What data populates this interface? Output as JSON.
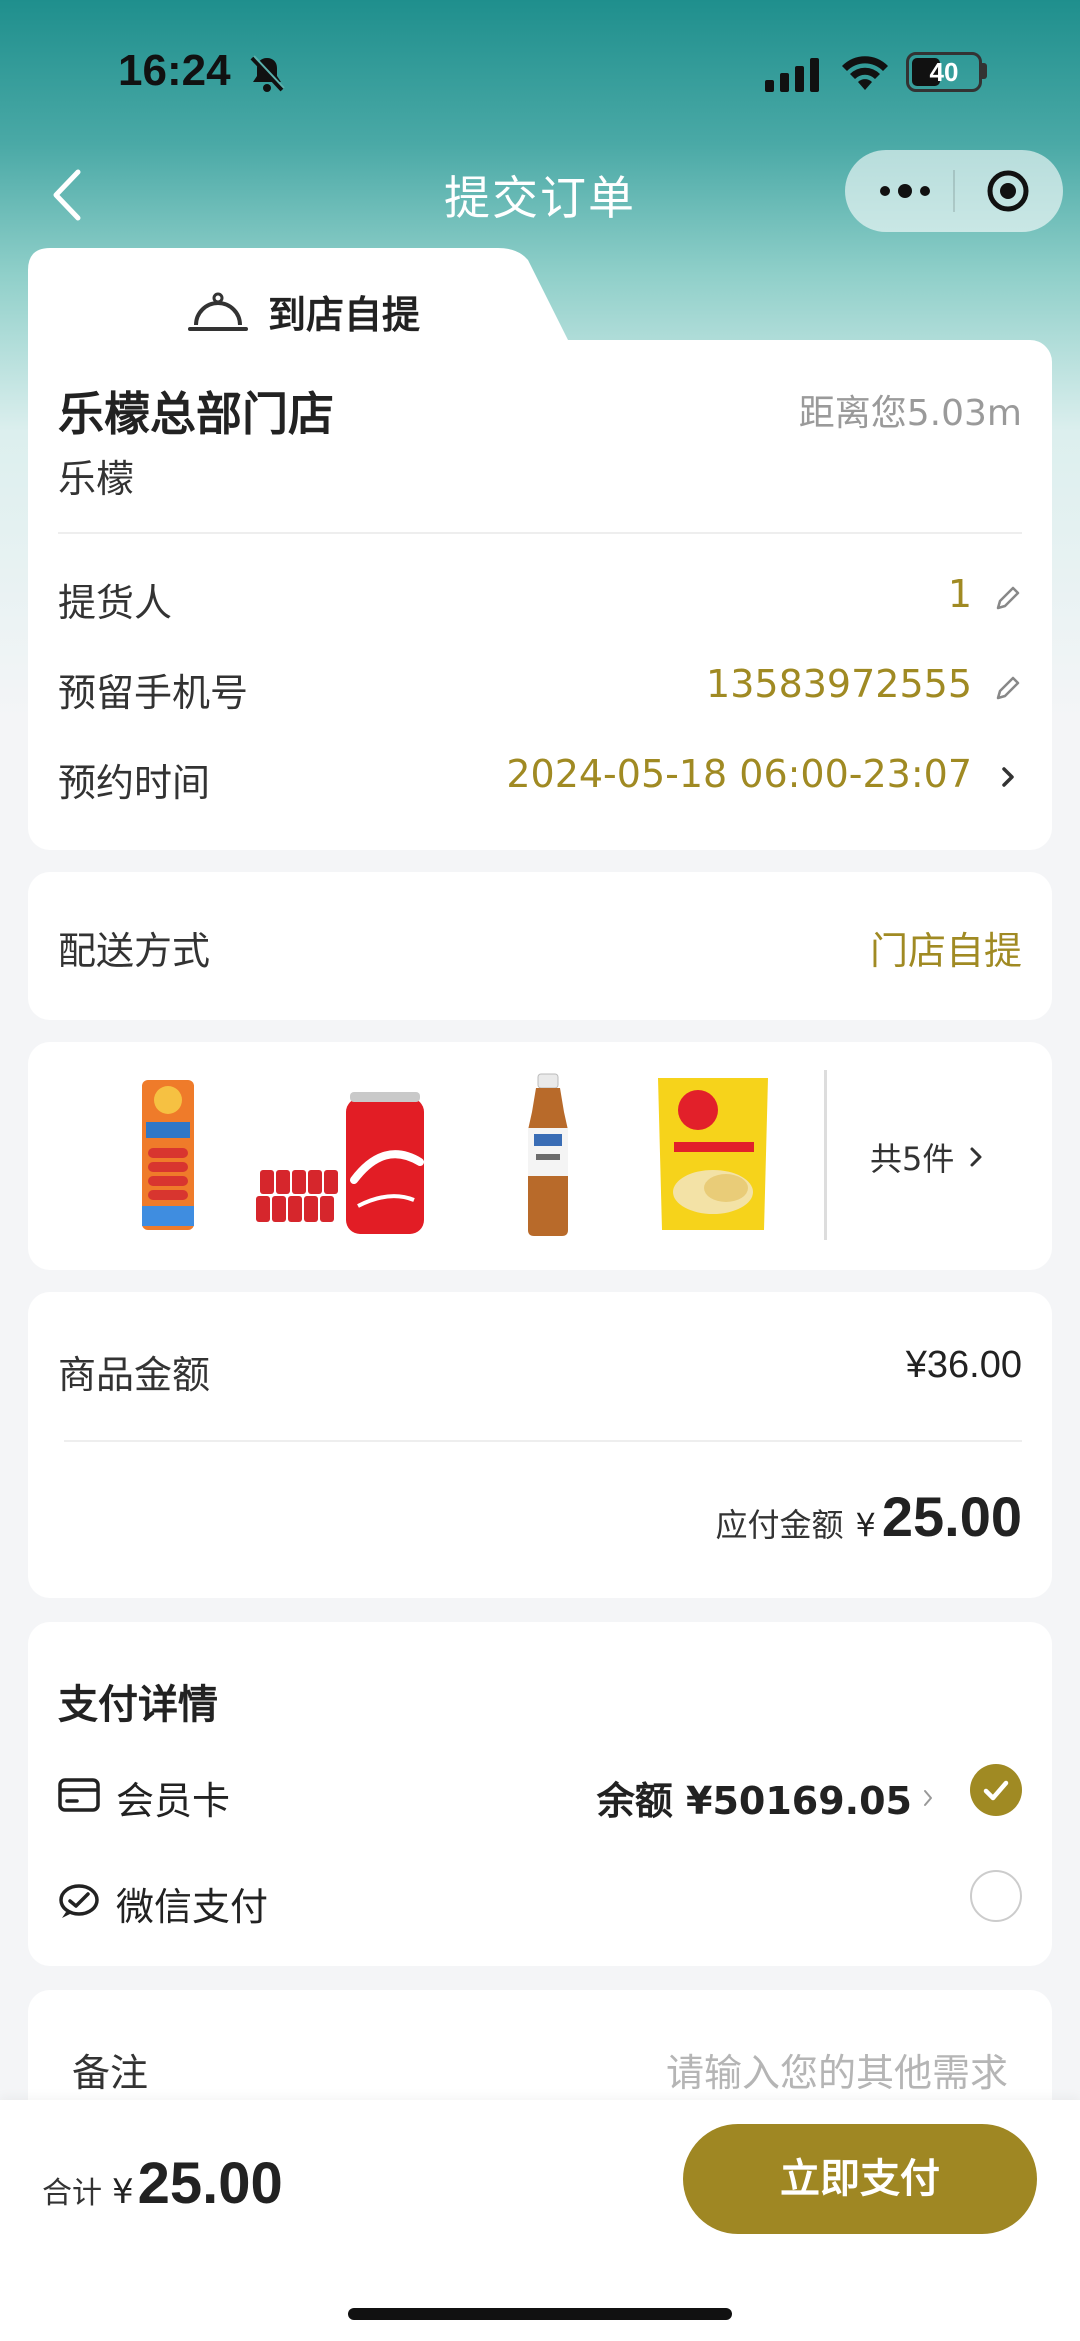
{
  "status_bar": {
    "time": "16:24",
    "battery": "40"
  },
  "nav": {
    "title": "提交订单"
  },
  "tab": {
    "label": "到店自提"
  },
  "store": {
    "name": "乐檬总部门店",
    "distance": "距离您5.03m",
    "brand": "乐檬"
  },
  "form": {
    "picker_label": "提货人",
    "picker_value": "1",
    "phone_label": "预留手机号",
    "phone_value": "13583972555",
    "time_label": "预约时间",
    "time_value": "2024-05-18 06:00-23:07"
  },
  "delivery": {
    "label": "配送方式",
    "value": "门店自提"
  },
  "goods": {
    "count_text": "共5件",
    "items": [
      "sausage-product",
      "coca-cola-cans",
      "tea-bottle",
      "lays-chips"
    ]
  },
  "amount": {
    "goods_label": "商品金额",
    "goods_value": "¥36.00",
    "payable_label": "应付金额",
    "currency": "¥",
    "payable_value": "25.00"
  },
  "payment": {
    "title": "支付详情",
    "member_card_label": "会员卡",
    "balance_text": "余额 ¥50169.05",
    "wechat_label": "微信支付"
  },
  "note": {
    "label": "备注",
    "placeholder": "请输入您的其他需求"
  },
  "bottom": {
    "total_label": "合计",
    "currency": "¥",
    "total_value": "25.00",
    "pay_button": "立即支付"
  },
  "colors": {
    "accent": "#a08a23",
    "header_teal": "#1f8f8d"
  }
}
